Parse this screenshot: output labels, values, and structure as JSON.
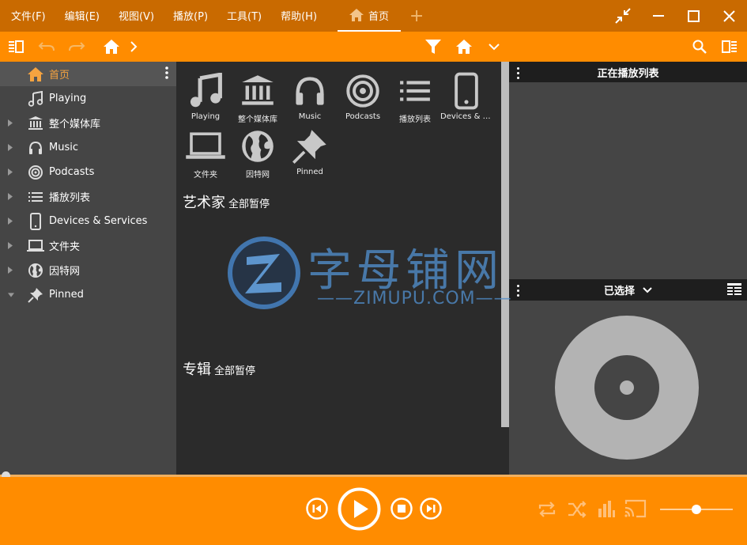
{
  "menu": {
    "items": [
      "文件(F)",
      "编辑(E)",
      "视图(V)",
      "播放(P)",
      "工具(T)",
      "帮助(H)"
    ],
    "home_tab": "首页",
    "add_tab": "+"
  },
  "sidebar": {
    "items": [
      {
        "label": "首页",
        "icon": "home-icon",
        "active": true
      },
      {
        "label": "Playing",
        "icon": "music-note-icon"
      },
      {
        "label": "整个媒体库",
        "icon": "library-icon"
      },
      {
        "label": "Music",
        "icon": "headphones-icon"
      },
      {
        "label": "Podcasts",
        "icon": "podcast-icon"
      },
      {
        "label": "播放列表",
        "icon": "playlist-icon"
      },
      {
        "label": "Devices & Services",
        "icon": "phone-icon"
      },
      {
        "label": "文件夹",
        "icon": "laptop-icon"
      },
      {
        "label": "因特网",
        "icon": "globe-icon"
      },
      {
        "label": "Pinned",
        "icon": "pin-icon"
      }
    ]
  },
  "grid": {
    "tiles": [
      {
        "label": "Playing",
        "icon": "music-note-icon"
      },
      {
        "label": "整个媒体库",
        "icon": "library-icon"
      },
      {
        "label": "Music",
        "icon": "headphones-icon"
      },
      {
        "label": "Podcasts",
        "icon": "podcast-icon"
      },
      {
        "label": "播放列表",
        "icon": "playlist-icon"
      },
      {
        "label": "Devices & S...",
        "icon": "phone-icon"
      },
      {
        "label": "文件夹",
        "icon": "laptop-icon"
      },
      {
        "label": "因特网",
        "icon": "globe-icon"
      },
      {
        "label": "Pinned",
        "icon": "pin-icon"
      }
    ]
  },
  "sections": {
    "artists": {
      "title": "艺术家",
      "sub": "全部暂停"
    },
    "albums": {
      "title": "专辑",
      "sub": "全部暂停"
    }
  },
  "right_panel": {
    "now_playing_title": "正在播放列表",
    "selected_title": "已选择"
  },
  "watermark": {
    "cn": "字母铺网",
    "en": "——ZIMUPU.COM——"
  },
  "player": {
    "volume": 0.5,
    "position": 0.0
  },
  "colors": {
    "menubar": "#c96a00",
    "accent": "#ff8c00",
    "sidebar": "#454545",
    "content": "#2b2b2b",
    "active_text": "#f5a340"
  }
}
